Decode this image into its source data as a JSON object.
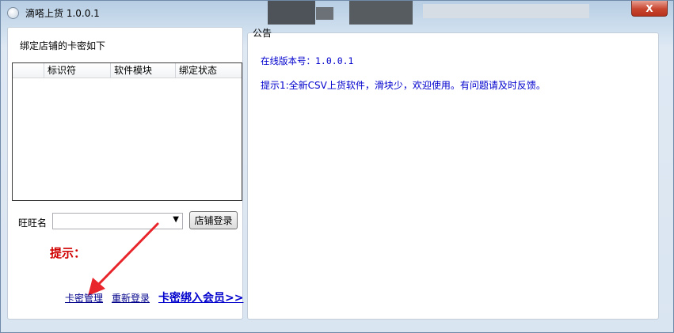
{
  "window": {
    "title": "滴嗒上货 1.0.0.1",
    "close_label": "X"
  },
  "left_panel": {
    "heading": "绑定店铺的卡密如下",
    "table": {
      "columns": [
        "标识符",
        "软件模块",
        "绑定状态"
      ],
      "rows": []
    },
    "wangwang_label": "旺旺名",
    "wangwang_value": "",
    "login_button": "店铺登录",
    "hint_label": "提示：",
    "links": {
      "card_manage": "卡密管理",
      "relogin": "重新登录",
      "bind_member": "卡密绑入会员>>"
    }
  },
  "announcement": {
    "title": "公告",
    "version_line": "在线版本号：1.0.0.1",
    "tip_line": "提示1:全新CSV上货软件，滑块少，欢迎使用。有问题请及时反馈。"
  },
  "colors": {
    "link": "#00008b",
    "hint_red": "#d00000",
    "notice_blue": "#0000cd",
    "arrow_red": "#e8252b"
  }
}
